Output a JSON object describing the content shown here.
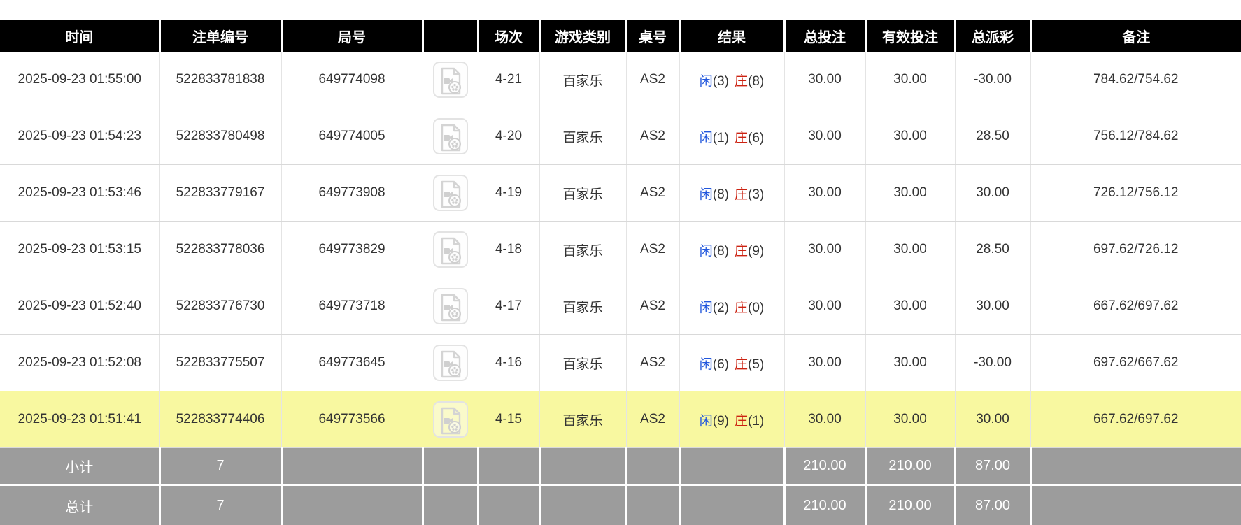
{
  "table": {
    "columns": [
      {
        "key": "time",
        "label": "时间"
      },
      {
        "key": "bet_id",
        "label": "注单编号"
      },
      {
        "key": "round",
        "label": "局号"
      },
      {
        "key": "video",
        "label": ""
      },
      {
        "key": "session",
        "label": "场次"
      },
      {
        "key": "game_type",
        "label": "游戏类别"
      },
      {
        "key": "table_no",
        "label": "桌号"
      },
      {
        "key": "result",
        "label": "结果"
      },
      {
        "key": "total_bet",
        "label": "总投注"
      },
      {
        "key": "valid_bet",
        "label": "有效投注"
      },
      {
        "key": "total_payout",
        "label": "总派彩"
      },
      {
        "key": "remark",
        "label": "备注"
      }
    ],
    "icons": {
      "video": "video-file-icon"
    },
    "rows": [
      {
        "time": "2025-09-23 01:55:00",
        "bet_id": "522833781838",
        "round": "649774098",
        "session": "4-21",
        "game_type": "百家乐",
        "table_no": "AS2",
        "result": {
          "xian_label": "闲",
          "xian_value": "(3)",
          "zhuang_label": "庄",
          "zhuang_value": "(8)"
        },
        "total_bet": "30.00",
        "valid_bet": "30.00",
        "total_payout": "-30.00",
        "remark": "784.62/754.62",
        "highlighted": false
      },
      {
        "time": "2025-09-23 01:54:23",
        "bet_id": "522833780498",
        "round": "649774005",
        "session": "4-20",
        "game_type": "百家乐",
        "table_no": "AS2",
        "result": {
          "xian_label": "闲",
          "xian_value": "(1)",
          "zhuang_label": "庄",
          "zhuang_value": "(6)"
        },
        "total_bet": "30.00",
        "valid_bet": "30.00",
        "total_payout": "28.50",
        "remark": "756.12/784.62",
        "highlighted": false
      },
      {
        "time": "2025-09-23 01:53:46",
        "bet_id": "522833779167",
        "round": "649773908",
        "session": "4-19",
        "game_type": "百家乐",
        "table_no": "AS2",
        "result": {
          "xian_label": "闲",
          "xian_value": "(8)",
          "zhuang_label": "庄",
          "zhuang_value": "(3)"
        },
        "total_bet": "30.00",
        "valid_bet": "30.00",
        "total_payout": "30.00",
        "remark": "726.12/756.12",
        "highlighted": false
      },
      {
        "time": "2025-09-23 01:53:15",
        "bet_id": "522833778036",
        "round": "649773829",
        "session": "4-18",
        "game_type": "百家乐",
        "table_no": "AS2",
        "result": {
          "xian_label": "闲",
          "xian_value": "(8)",
          "zhuang_label": "庄",
          "zhuang_value": "(9)"
        },
        "total_bet": "30.00",
        "valid_bet": "30.00",
        "total_payout": "28.50",
        "remark": "697.62/726.12",
        "highlighted": false
      },
      {
        "time": "2025-09-23 01:52:40",
        "bet_id": "522833776730",
        "round": "649773718",
        "session": "4-17",
        "game_type": "百家乐",
        "table_no": "AS2",
        "result": {
          "xian_label": "闲",
          "xian_value": "(2)",
          "zhuang_label": "庄",
          "zhuang_value": "(0)"
        },
        "total_bet": "30.00",
        "valid_bet": "30.00",
        "total_payout": "30.00",
        "remark": "667.62/697.62",
        "highlighted": false
      },
      {
        "time": "2025-09-23 01:52:08",
        "bet_id": "522833775507",
        "round": "649773645",
        "session": "4-16",
        "game_type": "百家乐",
        "table_no": "AS2",
        "result": {
          "xian_label": "闲",
          "xian_value": "(6)",
          "zhuang_label": "庄",
          "zhuang_value": "(5)"
        },
        "total_bet": "30.00",
        "valid_bet": "30.00",
        "total_payout": "-30.00",
        "remark": "697.62/667.62",
        "highlighted": false
      },
      {
        "time": "2025-09-23 01:51:41",
        "bet_id": "522833774406",
        "round": "649773566",
        "session": "4-15",
        "game_type": "百家乐",
        "table_no": "AS2",
        "result": {
          "xian_label": "闲",
          "xian_value": "(9)",
          "zhuang_label": "庄",
          "zhuang_value": "(1)"
        },
        "total_bet": "30.00",
        "valid_bet": "30.00",
        "total_payout": "30.00",
        "remark": "667.62/697.62",
        "highlighted": true
      }
    ],
    "summary": {
      "subtotal": {
        "label": "小计",
        "count": "7",
        "total_bet": "210.00",
        "valid_bet": "210.00",
        "total_payout": "87.00"
      },
      "total": {
        "label": "总计",
        "count": "7",
        "total_bet": "210.00",
        "valid_bet": "210.00",
        "total_payout": "87.00"
      }
    }
  },
  "colors": {
    "header_bg": "#000000",
    "header_text": "#ffffff",
    "highlight_row": "#f8f8a0",
    "summary_bg": "#9c9c9c",
    "bet_amount_blue": "#0a6cff",
    "negative_red": "#ff0000",
    "xian_blue": "#2257dd",
    "zhuang_red": "#cc2211"
  }
}
